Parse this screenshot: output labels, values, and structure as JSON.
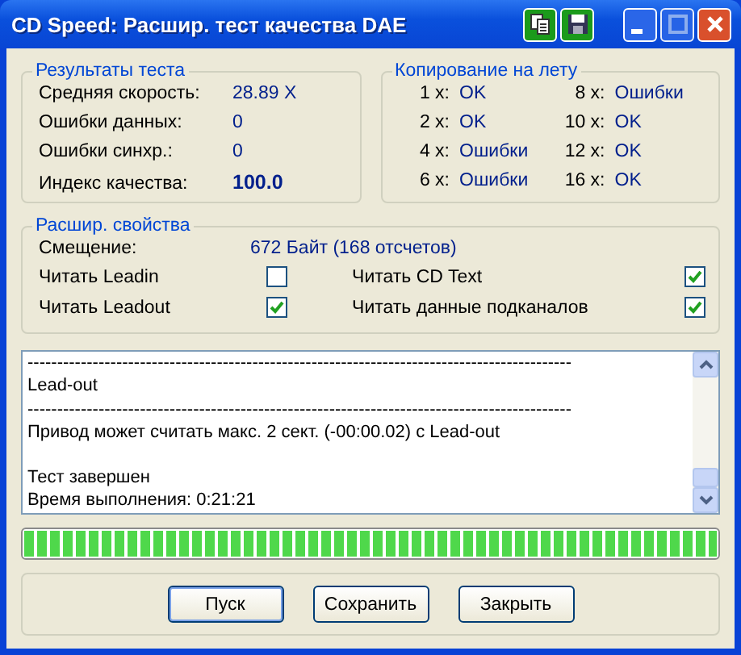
{
  "window": {
    "title": "CD Speed: Расшир. тест качества DAE"
  },
  "results": {
    "title": "Результаты теста",
    "rows": [
      {
        "label": "Средняя скорость:",
        "value": "28.89 X",
        "bold": false
      },
      {
        "label": "Ошибки данных:",
        "value": "0",
        "bold": false
      },
      {
        "label": "Ошибки синхр.:",
        "value": "0",
        "bold": false
      },
      {
        "label": "Индекс качества:",
        "value": "100.0",
        "bold": true
      }
    ]
  },
  "copy": {
    "title": "Копирование на лету",
    "rows": [
      {
        "speed": "1 x:",
        "result": "OK"
      },
      {
        "speed": "2 x:",
        "result": "OK"
      },
      {
        "speed": "4 x:",
        "result": "Ошибки"
      },
      {
        "speed": "6 x:",
        "result": "Ошибки"
      },
      {
        "speed": "8 x:",
        "result": "Ошибки"
      },
      {
        "speed": "10 x:",
        "result": "OK"
      },
      {
        "speed": "12 x:",
        "result": "OK"
      },
      {
        "speed": "16 x:",
        "result": "OK"
      }
    ]
  },
  "props": {
    "title": "Расшир. свойства",
    "offset_label": "Смещение:",
    "offset_value": "672 Байт (168 отсчетов)",
    "options": [
      {
        "label": "Читать Leadin",
        "checked": false
      },
      {
        "label": "Читать Leadout",
        "checked": true
      },
      {
        "label": "Читать CD Text",
        "checked": true
      },
      {
        "label": "Читать данные подканалов",
        "checked": true
      }
    ]
  },
  "log": {
    "paragraphs": [
      [
        "--------------------------------------------------------------------------------------------",
        "Lead-out",
        "--------------------------------------------------------------------------------------------",
        "Привод может считать макс. 2 сект. (-00:00.02) с Lead-out"
      ],
      [
        "Тест завершен",
        "Время выполнения:  0:21:21"
      ]
    ]
  },
  "progress": {
    "level": 1
  },
  "buttons": [
    "Пуск",
    "Сохранить",
    "Закрыть"
  ]
}
